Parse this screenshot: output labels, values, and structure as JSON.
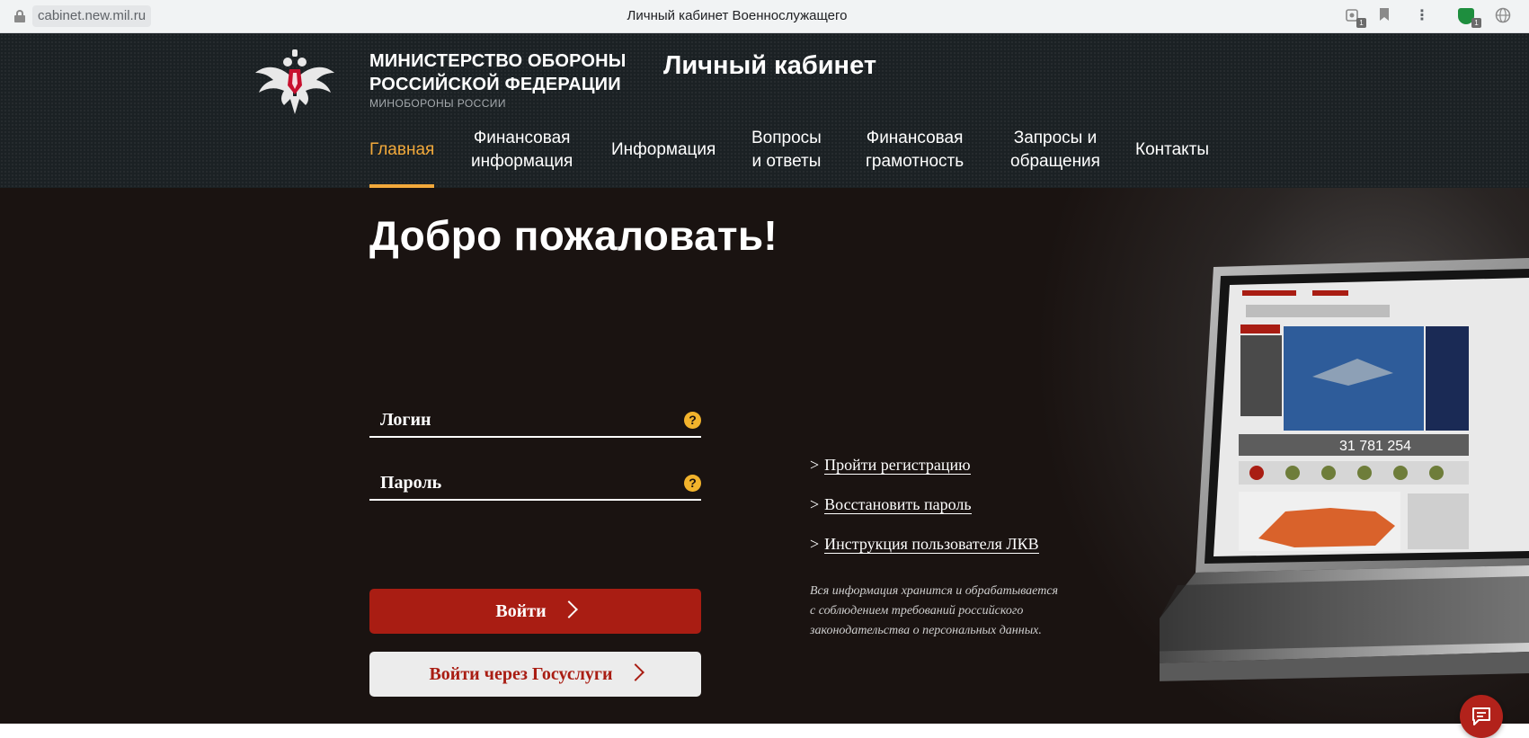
{
  "browser": {
    "url": "cabinet.new.mil.ru",
    "tab_title": "Личный кабинет Военнослужащего",
    "extension_badge": "1",
    "shield_badge": "1"
  },
  "header": {
    "ministry_line1": "МИНИСТЕРСТВО ОБОРОНЫ",
    "ministry_line2": "РОССИЙСКОЙ ФЕДЕРАЦИИ",
    "ministry_sub": "МИНОБОРОНЫ РОССИИ",
    "cabinet_title": "Личный кабинет"
  },
  "nav": {
    "items": [
      {
        "line1": "Главная",
        "line2": "",
        "active": true
      },
      {
        "line1": "Финансовая",
        "line2": "информация",
        "active": false
      },
      {
        "line1": "Информация",
        "line2": "",
        "active": false
      },
      {
        "line1": "Вопросы",
        "line2": "и ответы",
        "active": false
      },
      {
        "line1": "Финансовая",
        "line2": "грамотность",
        "active": false
      },
      {
        "line1": "Запросы и",
        "line2": "обращения",
        "active": false
      },
      {
        "line1": "Контакты",
        "line2": "",
        "active": false
      }
    ]
  },
  "hero": {
    "welcome": "Добро пожаловать!",
    "login_placeholder": "Логин",
    "password_placeholder": "Пароль",
    "help_glyph": "?",
    "login_button": "Войти",
    "gosuslugi_button": "Войти через Госуслуги",
    "links": [
      {
        "prefix": ">",
        "label": "Пройти регистрацию"
      },
      {
        "prefix": ">",
        "label": "Восстановить пароль"
      },
      {
        "prefix": ">",
        "label": "Инструкция пользователя ЛКВ"
      }
    ],
    "note_lines": [
      "Вся информация хранится и обрабатывается",
      "с соблюдением требований российского",
      "законодательства о персональных данных."
    ]
  },
  "laptop_screen": {
    "counter_text": "31 781 254"
  },
  "colors": {
    "accent": "#f2a93b",
    "primary_red": "#a91d13",
    "header_bg": "#1b2124",
    "hero_bg": "#1a1311"
  },
  "icons": {
    "lock": "lock-icon",
    "extension": "extension-icon",
    "bookmark": "bookmark-icon",
    "menu": "kebab-menu-icon",
    "shield": "shield-icon",
    "globe": "globe-icon",
    "help": "question-circle-icon",
    "chevron": "chevron-right-icon",
    "chat": "chat-bubble-icon"
  }
}
